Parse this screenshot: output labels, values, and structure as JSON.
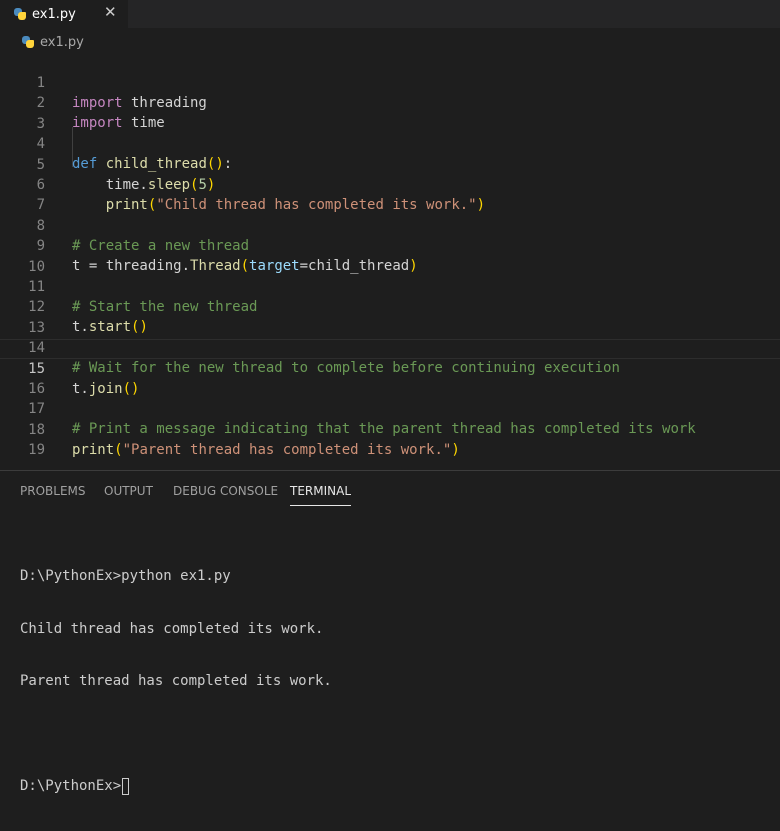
{
  "tab": {
    "label": "ex1.py",
    "close": "✕",
    "icon": "python-file-icon"
  },
  "breadcrumb": {
    "label": "ex1.py",
    "icon": "python-file-icon"
  },
  "editor": {
    "line_numbers": [
      "1",
      "2",
      "3",
      "4",
      "5",
      "6",
      "7",
      "8",
      "9",
      "10",
      "11",
      "12",
      "13",
      "14",
      "15",
      "16",
      "17",
      "18",
      "19"
    ],
    "current_line": 15,
    "code": {
      "l1_kw": "import",
      "l1_mod": " threading",
      "l2_kw": "import",
      "l2_mod": " time",
      "l4_kw": "def",
      "l4_fn": "child_thread",
      "l4_open": "(",
      "l4_close": ")",
      "l4_colon": ":",
      "l5_obj": "time.",
      "l5_fn": "sleep",
      "l5_open": "(",
      "l5_num": "5",
      "l5_close": ")",
      "l6_fn": "print",
      "l6_open": "(",
      "l6_str": "\"Child thread has completed its work.\"",
      "l6_close": ")",
      "l8_cm": "# Create a new thread",
      "l9_pre": "t = threading.",
      "l9_fn": "Thread",
      "l9_open": "(",
      "l9_prm": "target",
      "l9_eq": "=child_thread",
      "l9_close": ")",
      "l11_cm": "# Start the new thread",
      "l12_obj": "t.",
      "l12_fn": "start",
      "l12_paren": "()",
      "l14_cm": "# Wait for the new thread to complete before continuing execution",
      "l15_obj": "t.",
      "l15_fn": "join",
      "l15_paren": "()",
      "l17_cm": "# Print a message indicating that the parent thread has completed its work",
      "l18_fn": "print",
      "l18_open": "(",
      "l18_str": "\"Parent thread has completed its work.\"",
      "l18_close": ")"
    }
  },
  "panel": {
    "tabs": [
      "PROBLEMS",
      "OUTPUT",
      "DEBUG CONSOLE",
      "TERMINAL"
    ],
    "active_tab": "TERMINAL",
    "terminal": {
      "lines": [
        "D:\\PythonEx>python ex1.py",
        "Child thread has completed its work.",
        "Parent thread has completed its work.",
        "",
        "D:\\PythonEx>"
      ]
    }
  },
  "colors": {
    "keyword": "#569cd6",
    "import_keyword": "#c586c0",
    "function": "#dcdcaa",
    "string": "#ce9178",
    "number": "#b5cea8",
    "comment": "#6a9955",
    "bracket": "#ffd700",
    "parameter": "#9cdcfe",
    "background": "#1e1e1e"
  }
}
